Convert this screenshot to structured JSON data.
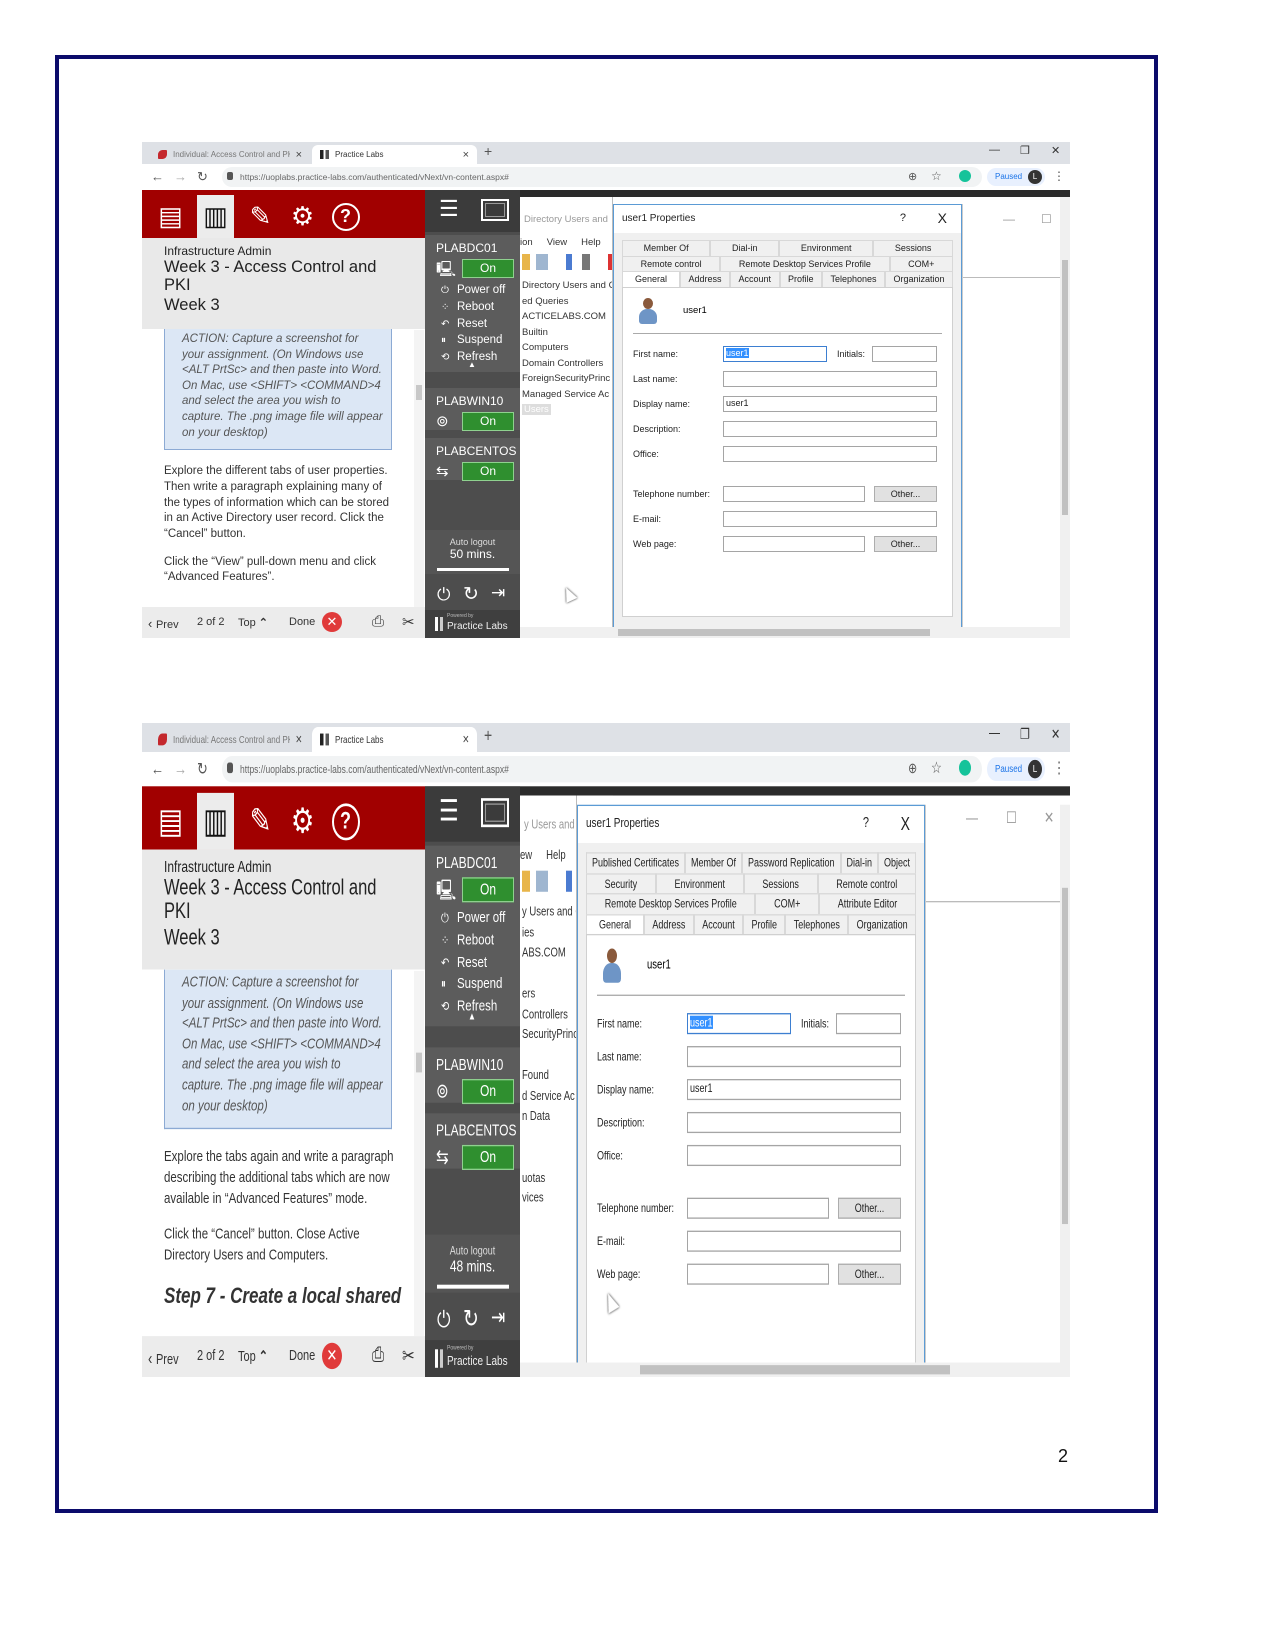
{
  "page_number": "2",
  "colors": {
    "page_border": "#0b0b6b",
    "lab_header": "#a10000",
    "vm_on": "#2f8f2f",
    "selection": "#3390ff"
  },
  "screenshots": [
    {
      "browser": {
        "tabs": [
          {
            "label": "Individual: Access Control and PKI"
          },
          {
            "label": "Practice Labs"
          }
        ],
        "url": "https://uoplabs.practice-labs.com/authenticated/vNext/vn-content.aspx#",
        "profile_status": "Paused",
        "profile_initial": "L"
      },
      "lesson": {
        "course": "Infrastructure Admin",
        "title": "Week 3 - Access Control and PKI",
        "subtitle": "Week 3",
        "action_note": "ACTION: Capture a screenshot for your assignment. (On Windows use <ALT PrtSc> and then paste into Word. On Mac, use <SHIFT> <COMMAND>4 and select the area you wish to capture. The .png image file will appear on your desktop)",
        "paragraphs": [
          "Explore the different tabs of user properties. Then write a paragraph explaining many of the types of information which can be stored in an Active Directory user record. Click the “Cancel” button.",
          "Click the “View” pull-down menu and click “Advanced Features”."
        ],
        "heading": ""
      },
      "nav": {
        "prev": "Prev",
        "page": "2 of 2",
        "top": "Top",
        "done": "Done"
      },
      "vms": [
        {
          "name": "PLABDC01",
          "status": "On",
          "actions": [
            "Power off",
            "Reboot",
            "Reset",
            "Suspend",
            "Refresh"
          ]
        },
        {
          "name": "PLABWIN10",
          "status": "On"
        },
        {
          "name": "PLABCENTOS",
          "status": "On"
        }
      ],
      "auto_logout": {
        "label": "Auto logout",
        "value": "50 mins."
      },
      "powered_by": "Powered by",
      "brand": "Practice Labs",
      "aduc": {
        "title": "Directory Users and",
        "menu": [
          "ion",
          "View",
          "Help"
        ],
        "tree": [
          "Directory Users and C",
          "ed Queries",
          "ACTICELABS.COM",
          "Builtin",
          "Computers",
          "Domain Controllers",
          "ForeignSecurityPrinc",
          "Managed Service Ac",
          "Users"
        ],
        "selected": "Users"
      },
      "dialog": {
        "title": "user1 Properties",
        "help": "?",
        "close": "X",
        "tab_rows": [
          [
            "Member Of",
            "Dial-in",
            "Environment",
            "Sessions"
          ],
          [
            "Remote control",
            "Remote Desktop Services Profile",
            "COM+"
          ],
          [
            "General",
            "Address",
            "Account",
            "Profile",
            "Telephones",
            "Organization"
          ]
        ],
        "active_tab": "General",
        "user": "user1",
        "initials_label": "Initials:",
        "fields": [
          {
            "label": "First name:",
            "value": "user1"
          },
          {
            "label": "Last name:",
            "value": ""
          },
          {
            "label": "Display name:",
            "value": "user1"
          },
          {
            "label": "Description:",
            "value": ""
          },
          {
            "label": "Office:",
            "value": ""
          },
          {
            "label": "Telephone number:",
            "value": "",
            "button": "Other..."
          },
          {
            "label": "E-mail:",
            "value": ""
          },
          {
            "label": "Web page:",
            "value": "",
            "button": "Other..."
          }
        ]
      }
    },
    {
      "browser": {
        "tabs": [
          {
            "label": "Individual: Access Control and PKI"
          },
          {
            "label": "Practice Labs"
          }
        ],
        "url": "https://uoplabs.practice-labs.com/authenticated/vNext/vn-content.aspx#",
        "profile_status": "Paused",
        "profile_initial": "L"
      },
      "lesson": {
        "course": "Infrastructure Admin",
        "title": "Week 3 - Access Control and PKI",
        "subtitle": "Week 3",
        "action_note": "ACTION: Capture a screenshot for your assignment. (On Windows use <ALT PrtSc> and then paste into Word. On Mac, use <SHIFT> <COMMAND>4 and select the area you wish to capture. The .png image file will appear on your desktop)",
        "paragraphs": [
          "Explore the tabs again and write a paragraph describing the additional tabs which are now available in “Advanced Features” mode.",
          "Click the “Cancel” button. Close Active Directory Users and Computers."
        ],
        "heading": "Step 7 - Create a local shared"
      },
      "nav": {
        "prev": "Prev",
        "page": "2 of 2",
        "top": "Top",
        "done": "Done"
      },
      "vms": [
        {
          "name": "PLABDC01",
          "status": "On",
          "actions": [
            "Power off",
            "Reboot",
            "Reset",
            "Suspend",
            "Refresh"
          ]
        },
        {
          "name": "PLABWIN10",
          "status": "On"
        },
        {
          "name": "PLABCENTOS",
          "status": "On"
        }
      ],
      "auto_logout": {
        "label": "Auto logout",
        "value": "48 mins."
      },
      "powered_by": "Powered by",
      "brand": "Practice Labs",
      "aduc": {
        "title": "y Users and",
        "menu": [
          "ew",
          "Help"
        ],
        "tree": [
          "y Users and C",
          "ies",
          "ABS.COM",
          "",
          "ers",
          "Controllers",
          "SecurityPrinc",
          "",
          "Found",
          "d Service Ac",
          "n Data",
          "",
          "",
          "uotas",
          "vices"
        ],
        "selected": ""
      },
      "dialog": {
        "title": "user1 Properties",
        "help": "?",
        "close": "X",
        "tab_rows": [
          [
            "Published Certificates",
            "Member Of",
            "Password Replication",
            "Dial-in",
            "Object"
          ],
          [
            "Security",
            "Environment",
            "Sessions",
            "Remote control"
          ],
          [
            "Remote Desktop Services Profile",
            "COM+",
            "Attribute Editor"
          ],
          [
            "General",
            "Address",
            "Account",
            "Profile",
            "Telephones",
            "Organization"
          ]
        ],
        "active_tab": "General",
        "user": "user1",
        "initials_label": "Initials:",
        "fields": [
          {
            "label": "First name:",
            "value": "user1"
          },
          {
            "label": "Last name:",
            "value": ""
          },
          {
            "label": "Display name:",
            "value": "user1"
          },
          {
            "label": "Description:",
            "value": ""
          },
          {
            "label": "Office:",
            "value": ""
          },
          {
            "label": "Telephone number:",
            "value": "",
            "button": "Other..."
          },
          {
            "label": "E-mail:",
            "value": ""
          },
          {
            "label": "Web page:",
            "value": "",
            "button": "Other..."
          }
        ]
      }
    }
  ]
}
